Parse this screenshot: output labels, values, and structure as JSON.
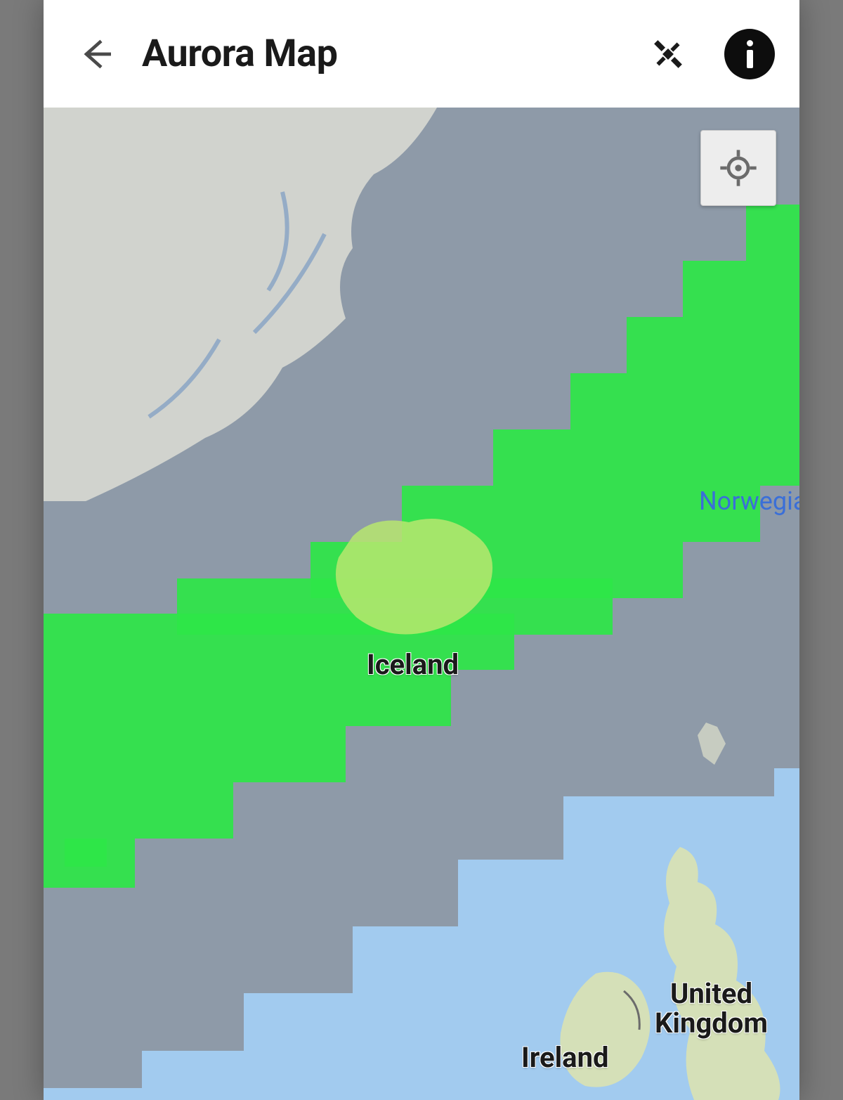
{
  "header": {
    "title": "Aurora Map",
    "back_icon": "arrow-left",
    "satellite_icon": "satellite",
    "info_icon": "info"
  },
  "map": {
    "locate_icon": "crosshair",
    "labels": {
      "iceland": "Iceland",
      "norwegian_sea": "Norwegian ",
      "uk": "United\nKingdom",
      "uk_line1": "United",
      "uk_line2": "Kingdom",
      "ireland": "Ireland"
    },
    "overlay": {
      "type": "aurora-probability",
      "color": "#2ee648"
    }
  }
}
